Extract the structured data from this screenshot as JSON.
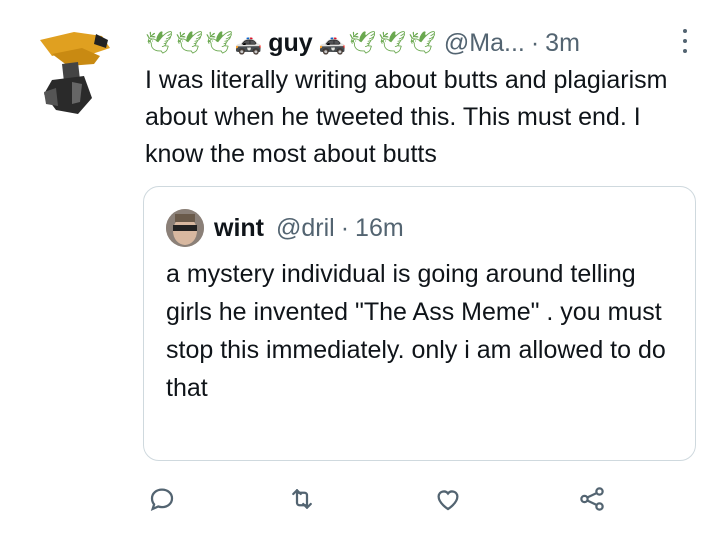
{
  "tweet": {
    "emoji_before_name": [
      "🕊",
      "🕊",
      "🕊",
      "🚓"
    ],
    "display_name": "guy",
    "emoji_after_name": [
      "🚓",
      "🕊",
      "🕊",
      "🕊"
    ],
    "handle": "@Ma...",
    "separator": "·",
    "time": "3m",
    "text": "I was literally writing about butts and plagiarism about when he tweeted this. This must end. I know the most about butts",
    "avatar_icon": "golden-hat-figure-avatar"
  },
  "quoted_tweet": {
    "display_name": "wint",
    "handle": "@dril",
    "separator": "·",
    "time": "16m",
    "text": "a mystery individual is going around telling girls he invented \"The Ass Meme\" . you must stop this immediately. only i am allowed to do that",
    "avatar_icon": "dril-face-avatar"
  },
  "actions": [
    {
      "icon": "reply-icon"
    },
    {
      "icon": "retweet-icon"
    },
    {
      "icon": "like-icon"
    },
    {
      "icon": "share-icon"
    }
  ],
  "colors": {
    "text": "#0f1419",
    "secondary": "#536471",
    "border": "#cfd9de"
  }
}
